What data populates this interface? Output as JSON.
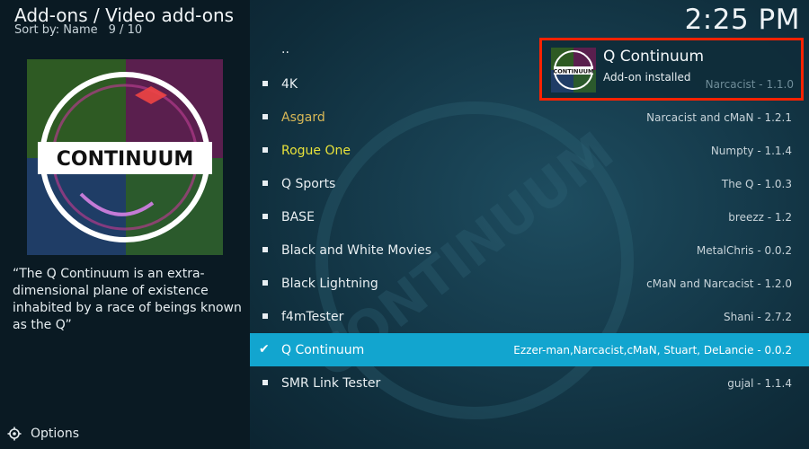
{
  "header": {
    "breadcrumb": "Add-ons / Video add-ons",
    "sort_label": "Sort by: Name",
    "item_count": "9 / 10",
    "clock": "2:25 PM"
  },
  "thumbnail": {
    "logo_text": "CONTINUUM"
  },
  "description": "“The Q Continuum is an extra-dimensional plane of existence inhabited by a race of beings known as the Q”",
  "footer": {
    "options_label": "Options"
  },
  "notification": {
    "title": "Q Continuum",
    "subtitle": "Add-on installed",
    "behind_text": "Narcacist - 1.1.0",
    "thumb_text": "CONTINUUM"
  },
  "list": {
    "parent": "..",
    "items": [
      {
        "name": "4K",
        "meta": "",
        "color": "#e9eff2"
      },
      {
        "name": "Asgard",
        "meta": "Narcacist and cMaN - 1.2.1",
        "color": "#d8b857"
      },
      {
        "name": "Rogue One",
        "meta": "Numpty - 1.1.4",
        "color": "#e8e23a"
      },
      {
        "name": "Q Sports",
        "meta": "The Q - 1.0.3",
        "color": "#e9eff2"
      },
      {
        "name": "BASE",
        "meta": "breezz - 1.2",
        "color": "#e9eff2"
      },
      {
        "name": "Black and White Movies",
        "meta": "MetalChris - 0.0.2",
        "color": "#e9eff2"
      },
      {
        "name": "Black Lightning",
        "meta": "cMaN and Narcacist - 1.2.0",
        "color": "#e9eff2"
      },
      {
        "name": "f4mTester",
        "meta": "Shani - 2.7.2",
        "color": "#e9eff2"
      },
      {
        "name": "Q Continuum",
        "meta": "Ezzer-man,Narcacist,cMaN, Stuart, DeLancie - 0.0.2",
        "color": "#ffffff"
      },
      {
        "name": "SMR Link Tester",
        "meta": "gujal - 1.1.4",
        "color": "#e9eff2"
      }
    ]
  },
  "watermark_text": "CONTINUUM",
  "colors": {
    "selection": "#12a5cf",
    "highlight_border": "#ff2200",
    "asgard": "#d8b857",
    "rogue_one": "#e8e23a"
  }
}
